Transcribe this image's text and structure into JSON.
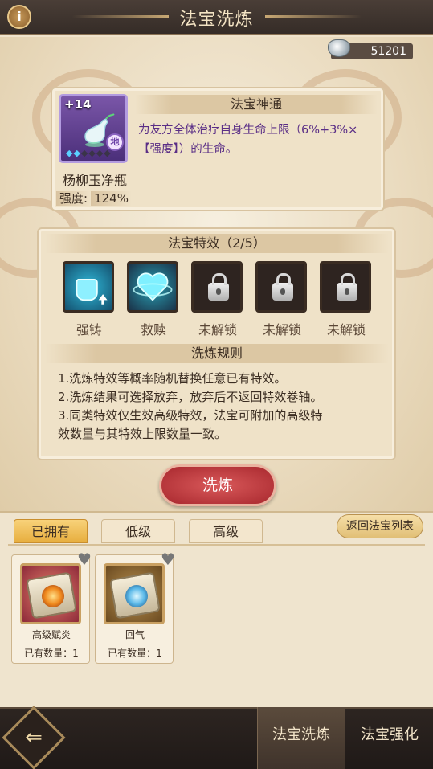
{
  "header": {
    "title": "法宝洗炼",
    "info_label": "i"
  },
  "currency": {
    "icon": "silver-ingot-icon",
    "amount": "51201"
  },
  "treasure": {
    "level": "+14",
    "grade_badge": "地",
    "name": "杨柳玉净瓶",
    "strength_label": "强度:",
    "strength_value": "124%"
  },
  "ability": {
    "heading": "法宝神通",
    "description": "为友方全体治疗自身生命上限（6%+3%×【强度】）的生命。"
  },
  "effects": {
    "heading": "法宝特效（2/5）",
    "items": [
      {
        "label": "强铸",
        "icon": "fist-up-icon"
      },
      {
        "label": "救赎",
        "icon": "heart-icon"
      },
      {
        "label": "未解锁",
        "icon": "lock-icon"
      },
      {
        "label": "未解锁",
        "icon": "lock-icon"
      },
      {
        "label": "未解锁",
        "icon": "lock-icon"
      }
    ]
  },
  "rules": {
    "heading": "洗炼规则",
    "lines": [
      "1.洗炼特效等概率随机替换任意已有特效。",
      "2.洗炼结果可选择放弃，放弃后不返回特效卷轴。",
      "3.同类特效仅生效高级特效，法宝可附加的高级特",
      "效数量与其特效上限数量一致。"
    ]
  },
  "refine_button": "洗炼",
  "tabs": {
    "owned": "已拥有",
    "low": "低级",
    "high": "高级"
  },
  "return_button": "返回法宝列表",
  "inventory": [
    {
      "name": "高级赋炎",
      "count": "已有数量：1",
      "icon": "fire-scroll-icon"
    },
    {
      "name": "回气",
      "count": "已有数量：1",
      "icon": "wind-scroll-icon"
    }
  ],
  "footer": {
    "back_icon": "back-arrow-icon",
    "tab_refine": "法宝洗炼",
    "tab_enhance": "法宝强化"
  },
  "colors": {
    "accent_red": "#c0393d",
    "active_tab": "#e7ae3e",
    "effect_text": "#5a2e86"
  }
}
